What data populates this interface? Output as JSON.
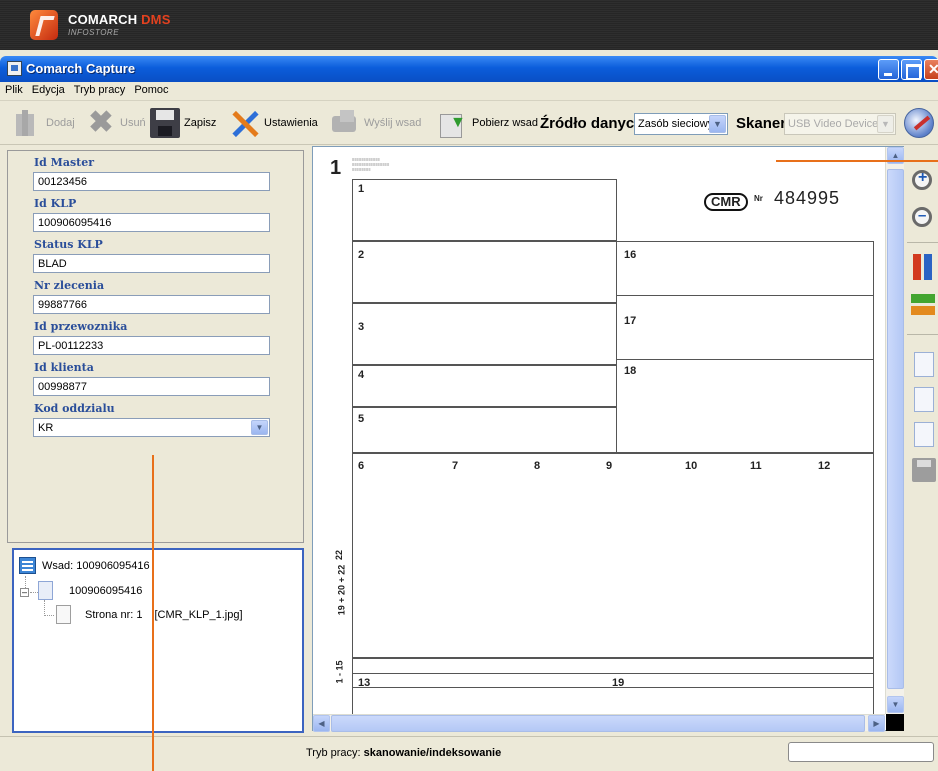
{
  "branding": {
    "brand_main": "COMARCH ",
    "brand_accent": "DMS",
    "brand_sub": "INFOSTORE",
    "accent_color": "#e3411f"
  },
  "window": {
    "title": "Comarch Capture"
  },
  "menu": {
    "items": [
      "Plik",
      "Edycja",
      "Tryb pracy",
      "Pomoc"
    ]
  },
  "toolbar": {
    "add_label": "Dodaj",
    "delete_label": "Usuń",
    "save_label": "Zapisz",
    "settings_label": "Ustawienia",
    "send_label": "Wyślij wsad",
    "fetch_label": "Pobierz wsad",
    "source_label": "Źródło danych:",
    "source_value": "Zasób sieciowy",
    "scanner_label": "Skaner:",
    "scanner_value": "USB Video Device"
  },
  "form": {
    "fields": [
      {
        "label": "Id Master",
        "value": "00123456"
      },
      {
        "label": "Id KLP",
        "value": "100906095416"
      },
      {
        "label": "Status KLP",
        "value": "BLAD"
      },
      {
        "label": "Nr zlecenia",
        "value": "99887766"
      },
      {
        "label": "Id przewoznika",
        "value": "PL-00112233"
      },
      {
        "label": "Id klienta",
        "value": "00998877"
      }
    ],
    "branch_label": "Kod oddzialu",
    "branch_value": "KR"
  },
  "tree": {
    "batch": "Wsad: 100906095416",
    "document": "100906095416",
    "page": "Strona nr: 1",
    "page_file": "[CMR_KLP_1.jpg]"
  },
  "document": {
    "page_number": "1",
    "cmr_badge": "CMR",
    "cmr_nr_label": "Nr",
    "cmr_number": "484995",
    "box_numbers": [
      "1",
      "2",
      "3",
      "4",
      "5",
      "6",
      "7",
      "8",
      "9",
      "10",
      "11",
      "12",
      "13",
      "16",
      "17",
      "18",
      "19"
    ],
    "side_numbers": [
      "22",
      "19 + 20 + 22",
      "1 - 15"
    ]
  },
  "status": {
    "mode_label": "Tryb pracy:",
    "mode_value": "skanowanie/indeksowanie"
  },
  "icons": {
    "add": "add-icon",
    "delete": "delete-icon",
    "save": "save-icon",
    "settings": "settings-icon",
    "send": "send-icon",
    "fetch": "fetch-icon",
    "scan": "scan-icon",
    "zoom_in": "zoom-in-icon",
    "zoom_out": "zoom-out-icon",
    "rotate": "rotate-icon",
    "flip": "flip-icon",
    "page": "page-icon",
    "disk": "save-disk-icon"
  }
}
